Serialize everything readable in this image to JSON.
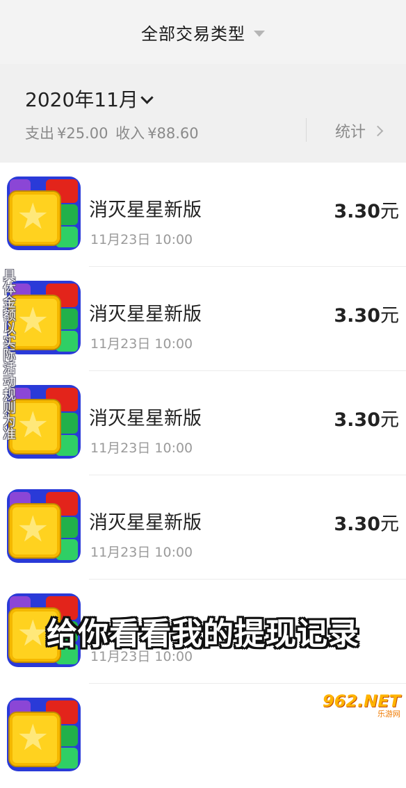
{
  "header": {
    "title": "全部交易类型"
  },
  "summary": {
    "month": "2020年11月",
    "expense_label": "支出",
    "expense_value": "¥25.00",
    "income_label": "收入",
    "income_value": "¥88.60",
    "stats_label": "统计"
  },
  "transactions": [
    {
      "name": "消灭星星新版",
      "time": "11月23日  10:00",
      "amount": "3.30",
      "unit": "元"
    },
    {
      "name": "消灭星星新版",
      "time": "11月23日  10:00",
      "amount": "3.30",
      "unit": "元"
    },
    {
      "name": "消灭星星新版",
      "time": "11月23日  10:00",
      "amount": "3.30",
      "unit": "元"
    },
    {
      "name": "消灭星星新版",
      "time": "11月23日  10:00",
      "amount": "3.30",
      "unit": "元"
    },
    {
      "name": "",
      "time": "11月23日  10:00",
      "amount": "",
      "unit": ""
    },
    {
      "name": "",
      "time": "",
      "amount": "",
      "unit": ""
    }
  ],
  "overlay": {
    "side_text": "具体金额以实际活动规则为准",
    "caption": "给你看看我的提现记录",
    "logo_text": "962.NET",
    "logo_sub": "乐游网"
  },
  "icons": {
    "app_icon": "game-star-icon",
    "dropdown": "caret-down-icon",
    "month_chevron": "chevron-down-icon",
    "stats_arrow": "chevron-right-icon"
  }
}
